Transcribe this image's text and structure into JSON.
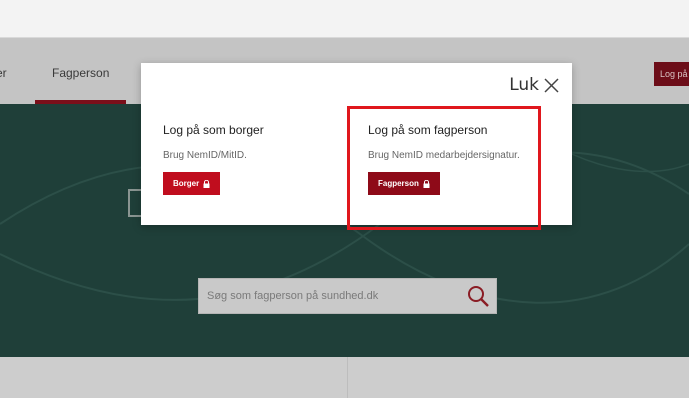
{
  "nav": {
    "left_tab_label": "er",
    "fagperson_tab_label": "Fagperson",
    "login_button_label": "Log på"
  },
  "search": {
    "placeholder": "Søg som fagperson på sundhed.dk"
  },
  "modal": {
    "close_label": "Luk",
    "borger": {
      "title": "Log på som borger",
      "description": "Brug NemID/MitID.",
      "button_label": "Borger"
    },
    "fagperson": {
      "title": "Log på som fagperson",
      "description": "Brug NemID medarbejdersignatur.",
      "button_label": "Fagperson"
    }
  },
  "colors": {
    "accent_red": "#c00d1e",
    "dark_red": "#8e0a18",
    "hero_teal": "#1f3f39",
    "highlight": "#e0171d"
  },
  "icons": {
    "close": "close-icon",
    "lock": "lock-icon",
    "search": "search-icon"
  }
}
